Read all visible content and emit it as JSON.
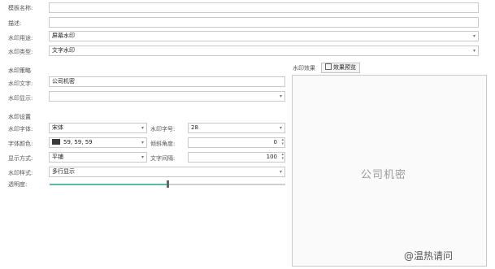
{
  "form": {
    "template_name_label": "模板名称:",
    "template_name_value": "",
    "description_label": "描述:",
    "description_value": "",
    "usage_label": "水印用途:",
    "usage_value": "屏幕水印",
    "type_label": "水印类型:",
    "type_value": "文字水印"
  },
  "content_section": {
    "title": "水印策略",
    "text_label": "水印文字:",
    "text_value": "公司机密",
    "display_label": "水印显示:",
    "display_value": ""
  },
  "settings_section": {
    "title": "水印设置",
    "font_label": "水印字体:",
    "font_value": "宋体",
    "size_label": "水印字号:",
    "size_value": "28",
    "color_label": "字体颜色:",
    "color_value": "59, 59, 59",
    "color_hex": "#3b3b3b",
    "tilt_label": "倾斜角度:",
    "tilt_value": "0",
    "display_mode_label": "显示方式:",
    "display_mode_value": "平铺",
    "spacing_label": "文字间隔:",
    "spacing_value": "100",
    "style_label": "水印样式:",
    "style_value": "多行显示",
    "opacity_label": "透明度:",
    "opacity_fraction": 0.5
  },
  "preview": {
    "label": "水印效果",
    "button_label": "效果预览",
    "sample_text": "公司机密"
  },
  "footer_watermark": "@温热请问",
  "colors": {
    "slider_fill": "#5fb7b1",
    "border": "#c9c9c9"
  }
}
